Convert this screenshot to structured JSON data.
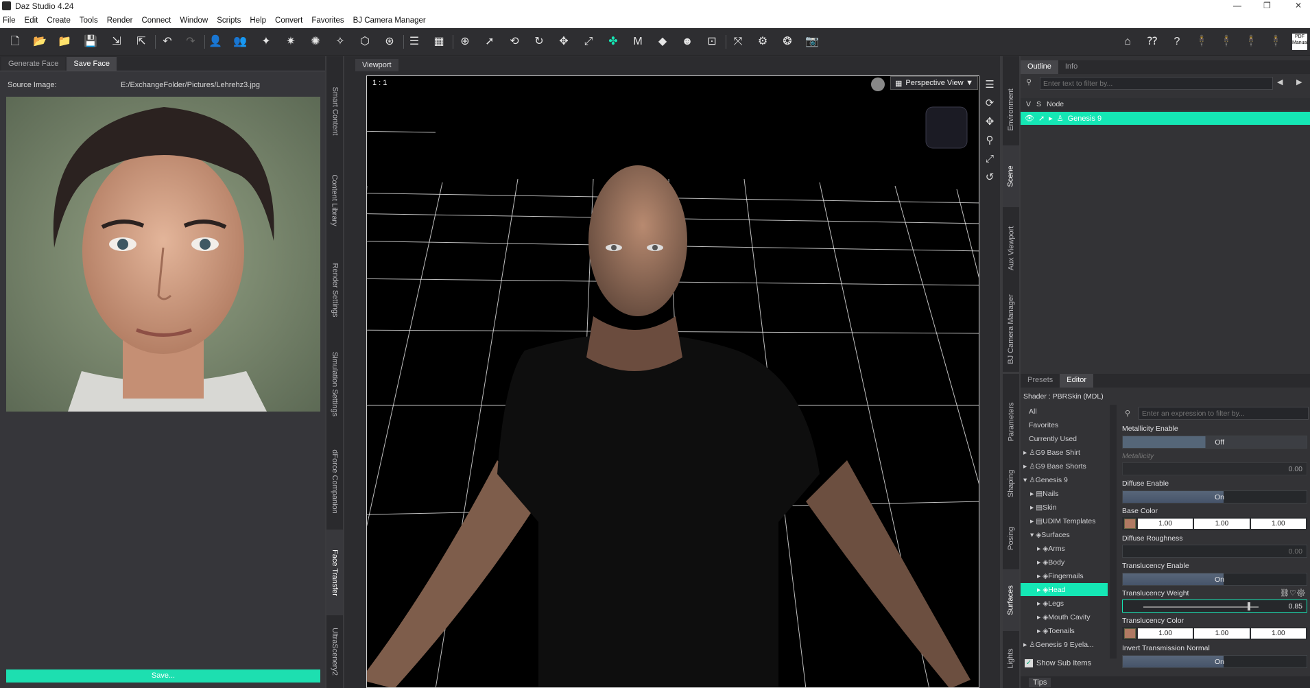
{
  "window": {
    "title": "Daz Studio 4.24"
  },
  "menu": [
    "File",
    "Edit",
    "Create",
    "Tools",
    "Render",
    "Connect",
    "Window",
    "Scripts",
    "Help",
    "Convert",
    "Favorites",
    "BJ Camera Manager"
  ],
  "left": {
    "tabs": [
      "Generate Face",
      "Save Face"
    ],
    "source_label": "Source Image:",
    "source_value": "E:/ExchangeFolder/Pictures/Lehrehz3.jpg",
    "save_button": "Save..."
  },
  "left_side_tabs": [
    "Smart Content",
    "Content Library",
    "Render Settings",
    "Simulation Settings",
    "dForce Companion",
    "Face Transfer",
    "UltraScenery2"
  ],
  "viewport": {
    "tab": "Viewport",
    "ratio": "1 : 1",
    "view": "Perspective View"
  },
  "right_side_tabs_top": [
    "Environment",
    "Scene",
    "Aux Viewport",
    "BJ Camera Manager"
  ],
  "right_side_tabs_bottom": [
    "Parameters",
    "Shaping",
    "Posing",
    "Surfaces",
    "Lights"
  ],
  "scene": {
    "tabs": [
      "Outline",
      "Info"
    ],
    "filter_placeholder": "Enter text to filter by...",
    "cols": [
      "V",
      "S",
      "Node"
    ],
    "node": "Genesis 9"
  },
  "surfaces": {
    "tabs": [
      "Presets",
      "Editor"
    ],
    "shader": "Shader : PBRSkin (MDL)",
    "filter_placeholder": "Enter an expression to filter by...",
    "tree": [
      "All",
      "Favorites",
      "Currently Used",
      "G9 Base Shirt",
      "G9 Base Shorts",
      "Genesis 9",
      "Nails",
      "Skin",
      "UDIM Templates",
      "Surfaces",
      "Arms",
      "Body",
      "Fingernails",
      "Head",
      "Legs",
      "Mouth Cavity",
      "Toenails",
      "Genesis 9 Eyela..."
    ],
    "show_sub": "Show Sub Items",
    "props": {
      "metallicity_enable": "Metallicity Enable",
      "metallicity_enable_val": "Off",
      "metallicity": "Metallicity",
      "metallicity_val": "0.00",
      "diffuse_enable": "Diffuse Enable",
      "diffuse_enable_val": "On",
      "base_color": "Base Color",
      "bc": [
        "1.00",
        "1.00",
        "1.00"
      ],
      "diffuse_rough": "Diffuse Roughness",
      "diffuse_rough_val": "0.00",
      "trans_enable": "Translucency Enable",
      "trans_enable_val": "On",
      "trans_weight": "Translucency Weight",
      "trans_weight_val": "0.85",
      "trans_color": "Translucency Color",
      "tc": [
        "1.00",
        "1.00",
        "1.00"
      ],
      "invert": "Invert Transmission Normal",
      "invert_val": "On"
    },
    "tips": "Tips"
  },
  "colors": {
    "accent": "#15e7b5"
  }
}
